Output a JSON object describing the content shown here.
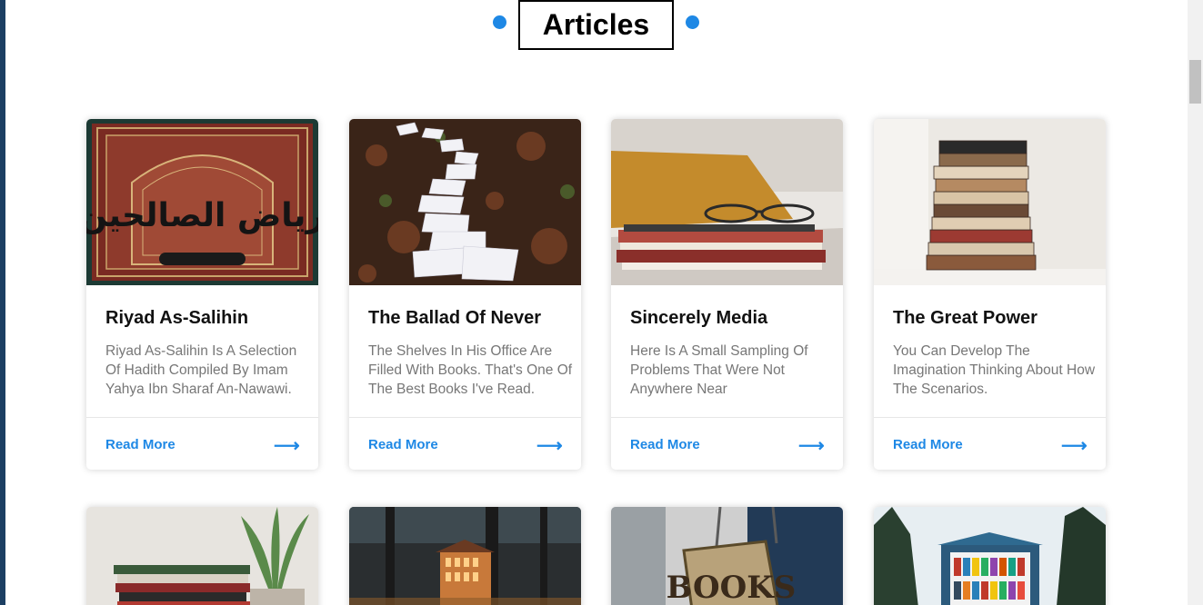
{
  "section": {
    "title": "Articles"
  },
  "articles": [
    {
      "title": "Riyad As-Salihin",
      "description": "Riyad As-Salihin Is A Selection Of Hadith Compiled By Imam Yahya Ibn Sharaf An-Nawawi.",
      "link": "Read More"
    },
    {
      "title": "The Ballad Of Never",
      "description": "The Shelves In His Office Are Filled With Books. That's One Of The Best Books I've Read.",
      "link": "Read More"
    },
    {
      "title": "Sincerely Media",
      "description": "Here Is A Small Sampling Of Problems That Were Not Anywhere Near",
      "link": "Read More"
    },
    {
      "title": "The Great Power",
      "description": "You Can Develop The Imagination Thinking About How The Scenarios.",
      "link": "Read More"
    }
  ],
  "colors": {
    "accent": "#1e88e5",
    "title": "#111111",
    "text": "#777777"
  },
  "icons": {
    "arrow": "arrow-right-icon"
  },
  "book_cover_text": "رياض الصالحين",
  "sign_text": "BOOKS"
}
